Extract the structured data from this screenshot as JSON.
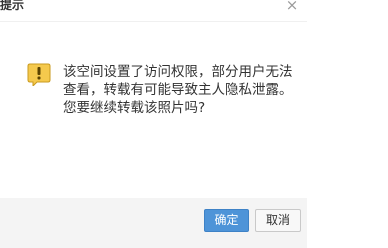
{
  "dialog": {
    "title": "提示",
    "close_glyph": "×",
    "icon": "warning-icon",
    "message_lines": [
      "该空间设置了访问权限，部分用户无法查看，转载有可能导致主人隐私泄露。",
      "您要继续转载该照片吗?"
    ],
    "buttons": {
      "ok": "确定",
      "cancel": "取消"
    }
  },
  "colors": {
    "primary_button": "#4e94d8",
    "warning_icon": "#f5c94d"
  }
}
